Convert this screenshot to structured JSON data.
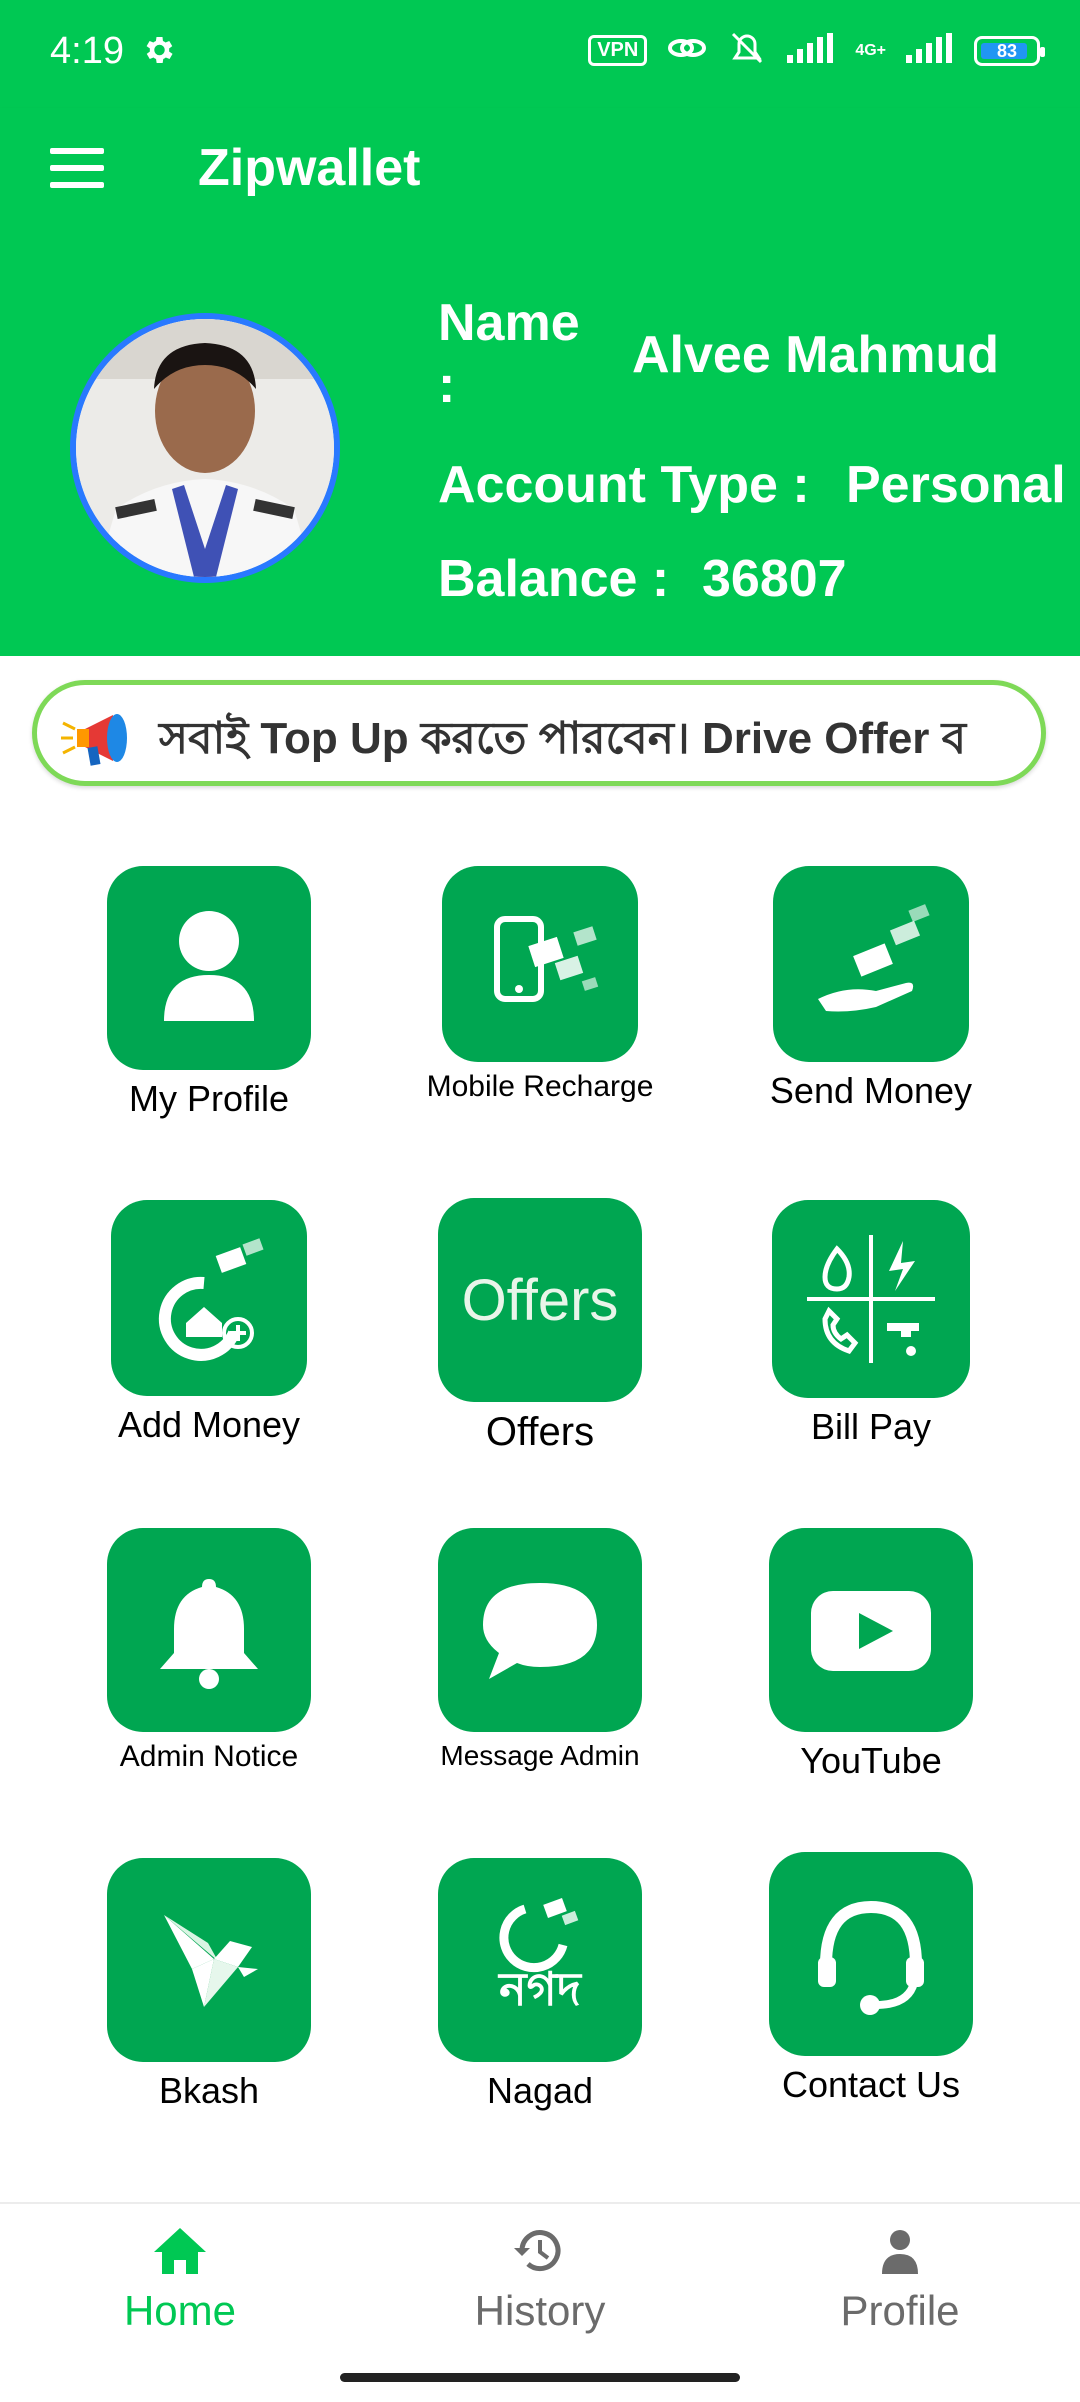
{
  "status_bar": {
    "time": "4:19",
    "vpn_label": "VPN",
    "network_label": "4G+",
    "battery": "83"
  },
  "app_bar": {
    "title": "Zipwallet"
  },
  "profile": {
    "name_label": "Name",
    "name_colon": ":",
    "name_value": "Alvee Mahmud",
    "account_type_label": "Account Type :",
    "account_type_value": "Personal",
    "balance_label": "Balance :",
    "balance_value": "36807"
  },
  "notice": {
    "text": "সবাই Top Up করতে পারবেন। Drive Offer ব"
  },
  "menu": {
    "my_profile": "My Profile",
    "mobile_recharge": "Mobile Recharge",
    "send_money": "Send Money",
    "add_money": "Add Money",
    "offers_icon_text": "Offers",
    "offers": "Offers",
    "bill_pay": "Bill Pay",
    "admin_notice": "Admin Notice",
    "message_admin": "Message Admin",
    "youtube": "YouTube",
    "bkash": "Bkash",
    "nagad_icon_text": "নগদ",
    "nagad": "Nagad",
    "contact_us": "Contact Us"
  },
  "bottom_nav": {
    "home": "Home",
    "history": "History",
    "profile": "Profile"
  },
  "colors": {
    "primary": "#00c853",
    "tile": "#00a651",
    "active_nav": "#00c853",
    "inactive_nav": "#6b6b6b"
  }
}
